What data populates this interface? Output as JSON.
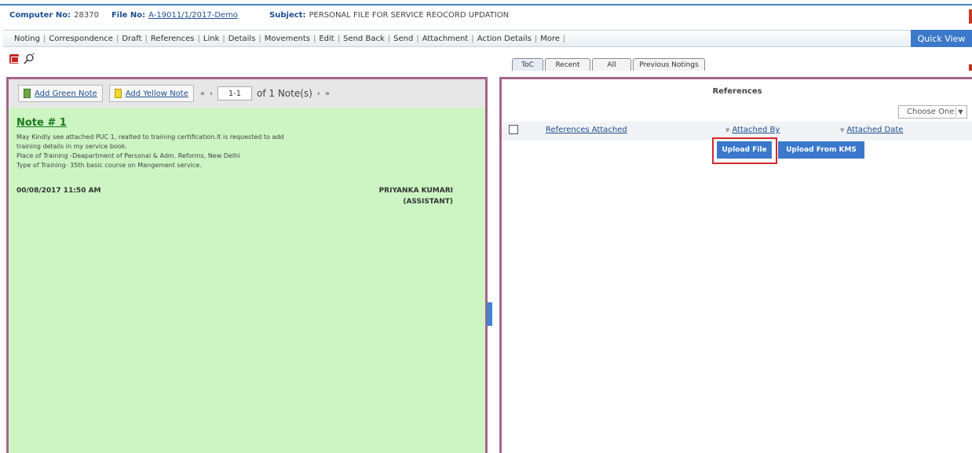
{
  "header": {
    "computer_no_label": "Computer No:",
    "computer_no_value": "28370",
    "file_no_label": "File No:",
    "file_no_value": "A-19011/1/2017-Demo",
    "subject_label": "Subject:",
    "subject_value": "PERSONAL FILE FOR SERVICE REOCORD UPDATION"
  },
  "menu": {
    "items": [
      "Noting",
      "Correspondence",
      "Draft",
      "References",
      "Link",
      "Details",
      "Movements",
      "Edit",
      "Send Back",
      "Send",
      "Attachment",
      "Action Details",
      "More"
    ],
    "quick_view": "Quick View"
  },
  "icons": {
    "pdf": "pdf-icon",
    "search": "search-plus-icon"
  },
  "tabs": [
    "ToC",
    "Recent",
    "All",
    "Previous Notings"
  ],
  "left": {
    "add_green": "Add Green Note",
    "add_yellow": "Add Yellow Note",
    "nav_first": "«",
    "nav_prev": "‹",
    "page_value": "1-1",
    "page_of": "of 1 Note(s)",
    "nav_next": "›",
    "nav_last": "»",
    "note": {
      "title": "Note # 1",
      "lines": [
        "May Kindly see attached PUC 1, realted to training certification.It is requested to add",
        "training details in my service book.",
        "Place of Training -Deapartment of Personal & Adm. Reforms, New Delhi",
        "Type of Training- 35th basic course on Mangement service."
      ],
      "date": "00/08/2017 11:50 AM",
      "author": "PRIYANKA KUMARI",
      "designation": "(ASSISTANT)"
    }
  },
  "right": {
    "title": "References",
    "choose": "Choose One",
    "col_refs": "References Attached",
    "col_by": "Attached By",
    "col_date": "Attached Date",
    "upload_file": "Upload File",
    "upload_kms": "Upload From KMS"
  },
  "colors": {
    "accent": "#3b78cc",
    "panel_border": "#a6648a",
    "note_bg": "#ccf5c3",
    "highlight": "#d42a2a"
  }
}
